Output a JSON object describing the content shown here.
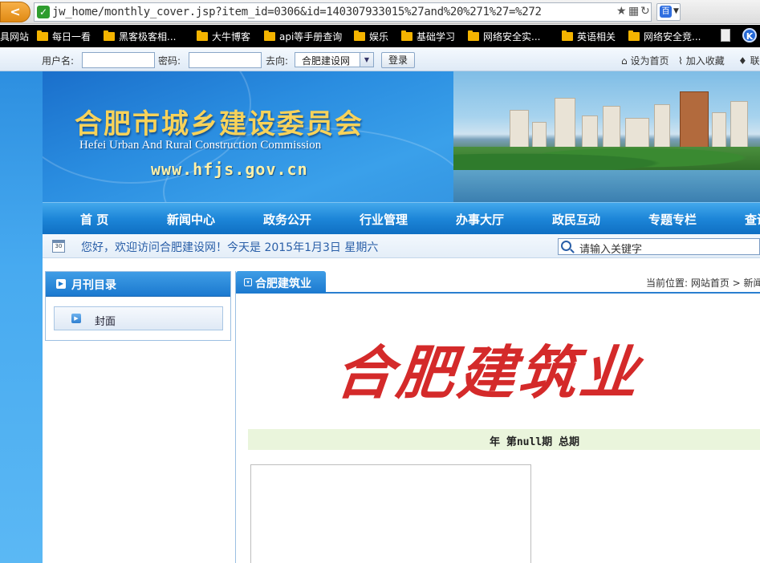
{
  "browser": {
    "back_glyph": "<",
    "url": "jw_home/monthly_cover.jsp?item_id=0306&id=140307933015%27and%20%271%27=%272",
    "secure_glyph": "✓",
    "paw_glyph": "百"
  },
  "bookmarks": [
    {
      "label": "具网站",
      "folder": false
    },
    {
      "label": "每日一看",
      "folder": true
    },
    {
      "label": "黑客极客相...",
      "folder": true
    },
    {
      "label": "大牛博客",
      "folder": true
    },
    {
      "label": "api等手册查询",
      "folder": true
    },
    {
      "label": "娱乐",
      "folder": true
    },
    {
      "label": "基础学习",
      "folder": true
    },
    {
      "label": "网络安全实...",
      "folder": true
    },
    {
      "label": "英语相关",
      "folder": true
    },
    {
      "label": "网络安全竞...",
      "folder": true
    }
  ],
  "bookmark_k": "K",
  "login": {
    "username_label": "用户名:",
    "password_label": "密码:",
    "goto_label": "去向:",
    "goto_value": "合肥建设网",
    "login_button": "登录",
    "set_home": "设为首页",
    "add_fav": "加入收藏",
    "contact": "联系"
  },
  "banner": {
    "title": "合肥市城乡建设委员会",
    "subtitle": "Hefei Urban And Rural Construction Commission",
    "url": "www.hfjs.gov.cn"
  },
  "nav": [
    "首 页",
    "新闻中心",
    "政务公开",
    "行业管理",
    "办事大厅",
    "政民互动",
    "专题专栏",
    "查询"
  ],
  "datebar": {
    "calendar_day": "30",
    "welcome": "您好，欢迎访问合肥建设网！今天是  2015年1月3日  星期六",
    "search_placeholder": "请输入关键字"
  },
  "sidebar": {
    "title": "月刊目录",
    "items": [
      {
        "label": "封面"
      }
    ]
  },
  "main": {
    "tab_label": "合肥建筑业",
    "breadcrumb": "当前位置: 网站首页 > 新闻",
    "magazine_title": "合肥建筑业",
    "issue_line": "年 第null期 总期"
  }
}
